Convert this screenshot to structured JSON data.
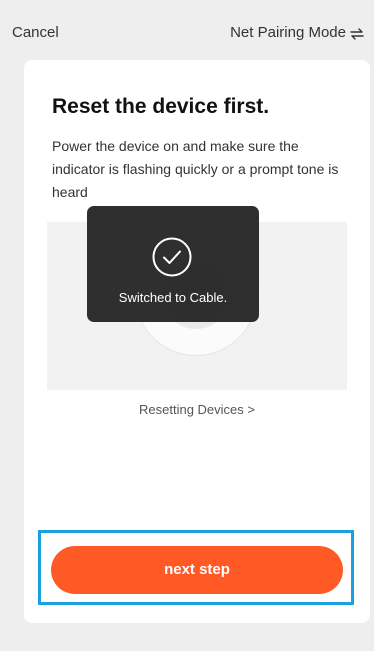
{
  "header": {
    "cancel_label": "Cancel",
    "mode_label": "Net Pairing Mode",
    "mode_icon": "switch-arrows-icon"
  },
  "card": {
    "title": "Reset the device first.",
    "description": "Power the device on and make sure the indicator is flashing quickly or a prompt tone is heard",
    "reset_link": "Resetting Devices >"
  },
  "toast": {
    "message": "Switched to Cable.",
    "icon": "check-circle-icon"
  },
  "actions": {
    "next_label": "next step"
  },
  "colors": {
    "accent": "#ff5a26",
    "highlight_frame": "#1aa2e0",
    "background": "#eeeeee",
    "card": "#ffffff"
  }
}
